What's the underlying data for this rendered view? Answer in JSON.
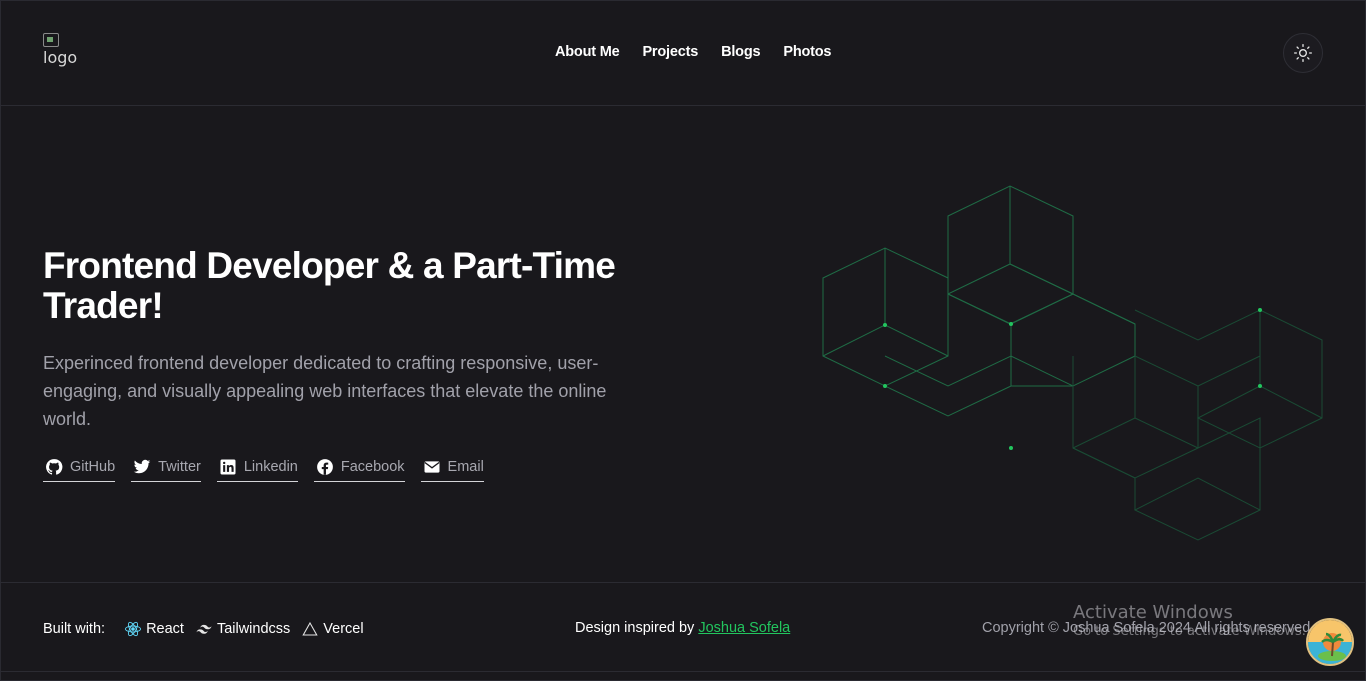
{
  "header": {
    "logo_alt": "logo",
    "nav": [
      {
        "label": "About Me"
      },
      {
        "label": "Projects"
      },
      {
        "label": "Blogs"
      },
      {
        "label": "Photos"
      }
    ],
    "theme_icon": "sun-icon"
  },
  "hero": {
    "title": "Frontend Developer & a Part-Time Trader!",
    "description": "Experinced frontend developer dedicated to crafting responsive, user-engaging, and visually appealing web interfaces that elevate the online world.",
    "socials": [
      {
        "label": "GitHub",
        "icon": "github-icon"
      },
      {
        "label": "Twitter",
        "icon": "twitter-icon"
      },
      {
        "label": "Linkedin",
        "icon": "linkedin-icon"
      },
      {
        "label": "Facebook",
        "icon": "facebook-icon"
      },
      {
        "label": "Email",
        "icon": "mail-icon"
      }
    ],
    "accent_color": "#22c55e"
  },
  "footer": {
    "built_label": "Built with:",
    "tech": [
      {
        "label": "React",
        "icon": "react-icon"
      },
      {
        "label": "Tailwindcss",
        "icon": "tailwind-icon"
      },
      {
        "label": "Vercel",
        "icon": "vercel-icon"
      }
    ],
    "inspired_prefix": "Design inspired by",
    "inspired_name": "Joshua Sofela",
    "copyright": "Copyright © Joshua Sofela 2024 All rights reserved"
  },
  "watermark": {
    "line1": "Activate Windows",
    "line2": "Go to Settings to activate Windows."
  }
}
